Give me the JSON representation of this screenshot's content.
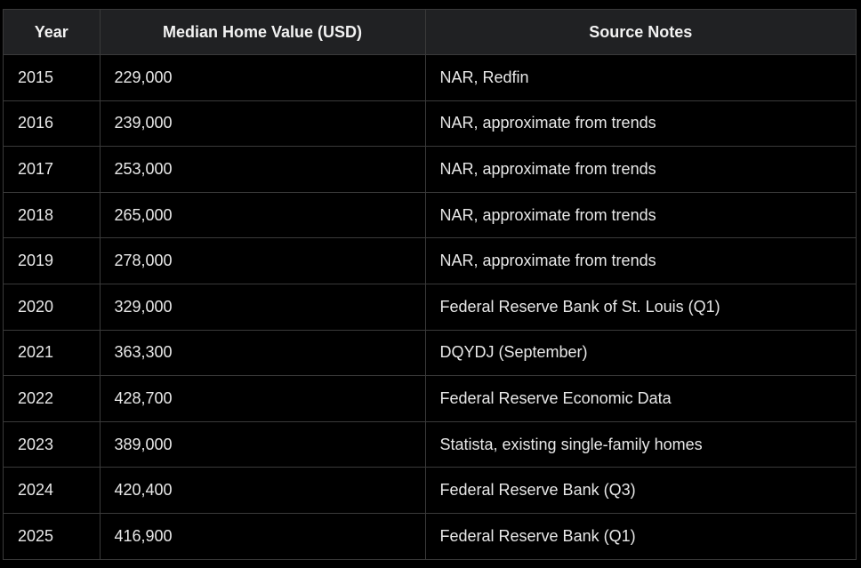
{
  "table": {
    "headers": [
      "Year",
      "Median Home Value (USD)",
      "Source Notes"
    ],
    "rows": [
      [
        "2015",
        "229,000",
        "NAR, Redfin"
      ],
      [
        "2016",
        "239,000",
        "NAR, approximate from trends"
      ],
      [
        "2017",
        "253,000",
        "NAR, approximate from trends"
      ],
      [
        "2018",
        "265,000",
        "NAR, approximate from trends"
      ],
      [
        "2019",
        "278,000",
        "NAR, approximate from trends"
      ],
      [
        "2020",
        "329,000",
        "Federal Reserve Bank of St. Louis (Q1)"
      ],
      [
        "2021",
        "363,300",
        "DQYDJ (September)"
      ],
      [
        "2022",
        "428,700",
        "Federal Reserve Economic Data"
      ],
      [
        "2023",
        "389,000",
        "Statista, existing single-family homes"
      ],
      [
        "2024",
        "420,400",
        "Federal Reserve Bank (Q3)"
      ],
      [
        "2025",
        "416,900",
        "Federal Reserve Bank (Q1)"
      ]
    ]
  },
  "colors": {
    "background": "#000000",
    "header_background": "#202123",
    "border": "#3a3a3a",
    "text": "#e8e8e8"
  }
}
